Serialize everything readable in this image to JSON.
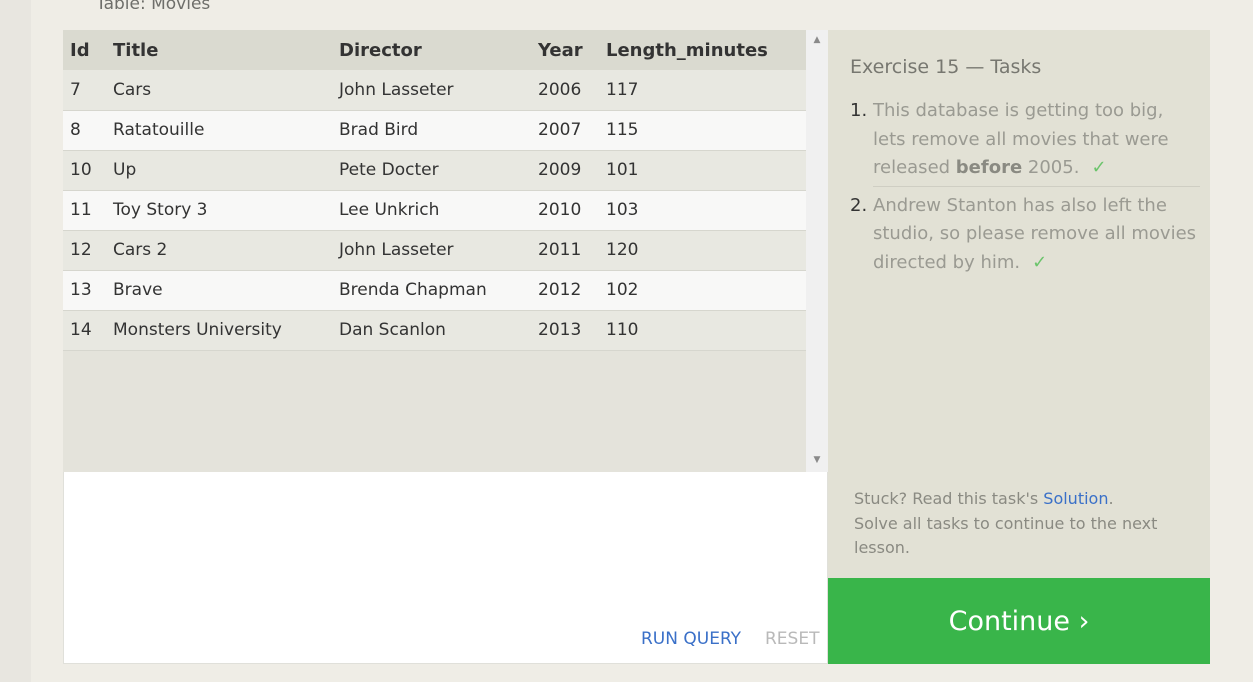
{
  "table_caption": "Table: Movies",
  "results": {
    "columns": [
      "Id",
      "Title",
      "Director",
      "Year",
      "Length_minutes"
    ],
    "rows": [
      [
        "7",
        "Cars",
        "John Lasseter",
        "2006",
        "117"
      ],
      [
        "8",
        "Ratatouille",
        "Brad Bird",
        "2007",
        "115"
      ],
      [
        "10",
        "Up",
        "Pete Docter",
        "2009",
        "101"
      ],
      [
        "11",
        "Toy Story 3",
        "Lee Unkrich",
        "2010",
        "103"
      ],
      [
        "12",
        "Cars 2",
        "John Lasseter",
        "2011",
        "120"
      ],
      [
        "13",
        "Brave",
        "Brenda Chapman",
        "2012",
        "102"
      ],
      [
        "14",
        "Monsters University",
        "Dan Scanlon",
        "2013",
        "110"
      ]
    ]
  },
  "editor": {
    "query": "",
    "run_label": "RUN QUERY",
    "reset_label": "RESET"
  },
  "tasks": {
    "title": "Exercise 15 — Tasks",
    "items": [
      {
        "num": "1.",
        "text_before": "This database is getting too big, lets remove all movies that were released ",
        "bold": "before",
        "text_after": " 2005.",
        "check": "✓"
      },
      {
        "num": "2.",
        "text": "Andrew Stanton has also left the studio, so please remove all movies directed by him.",
        "check": "✓"
      }
    ],
    "stuck_prefix": "Stuck? Read this task's ",
    "solution_link": "Solution",
    "stuck_suffix": ".",
    "solve_all": "Solve all tasks to continue to the next lesson."
  },
  "continue_label": "Continue ›",
  "colors": {
    "continue_bg": "#39b54a",
    "link": "#3a70c8",
    "check": "#6bc46b"
  }
}
